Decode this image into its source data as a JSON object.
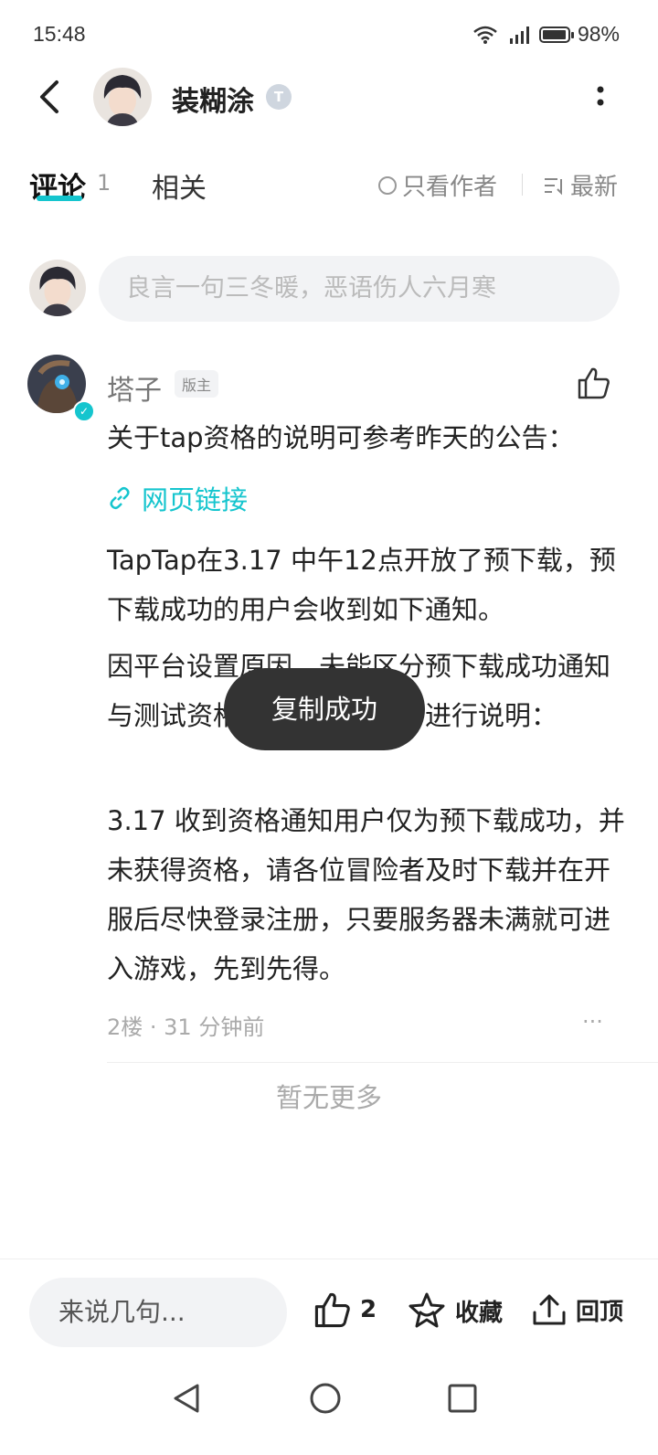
{
  "status_bar": {
    "time": "15:48",
    "battery": "98%"
  },
  "header": {
    "username": "装糊涂",
    "level_badge": "T"
  },
  "tabs": {
    "comments_label": "评论",
    "comments_count": "1",
    "related_label": "相关"
  },
  "filters": {
    "author_only": "只看作者",
    "sort": "最新"
  },
  "reply": {
    "placeholder": "良言一句三冬暖，恶语伤人六月寒"
  },
  "comment": {
    "author": "塔子",
    "role_badge": "版主",
    "intro": "关于tap资格的说明可参考昨天的公告：",
    "link_text": "网页链接",
    "paragraphs": [
      "TapTap在3.17 中午12点开放了预下载，预下载成功的用户会收到如下通知。",
      "因平台设置原因，未能区分预下载成功通知与测试资格通知，在此统一进行说明：",
      "3.17 收到资格通知用户仅为预下载成功，并未获得资格，请各位冒险者及时下载并在开服后尽快登录注册，只要服务器未满就可进入游戏，先到先得。"
    ],
    "meta": "2楼 · 31 分钟前",
    "more": "···"
  },
  "list_end": "暂无更多",
  "toast": "复制成功",
  "bottom": {
    "input_placeholder": "来说几句...",
    "like_count": "2",
    "favorite_label": "收藏",
    "back_to_top_label": "回顶"
  }
}
